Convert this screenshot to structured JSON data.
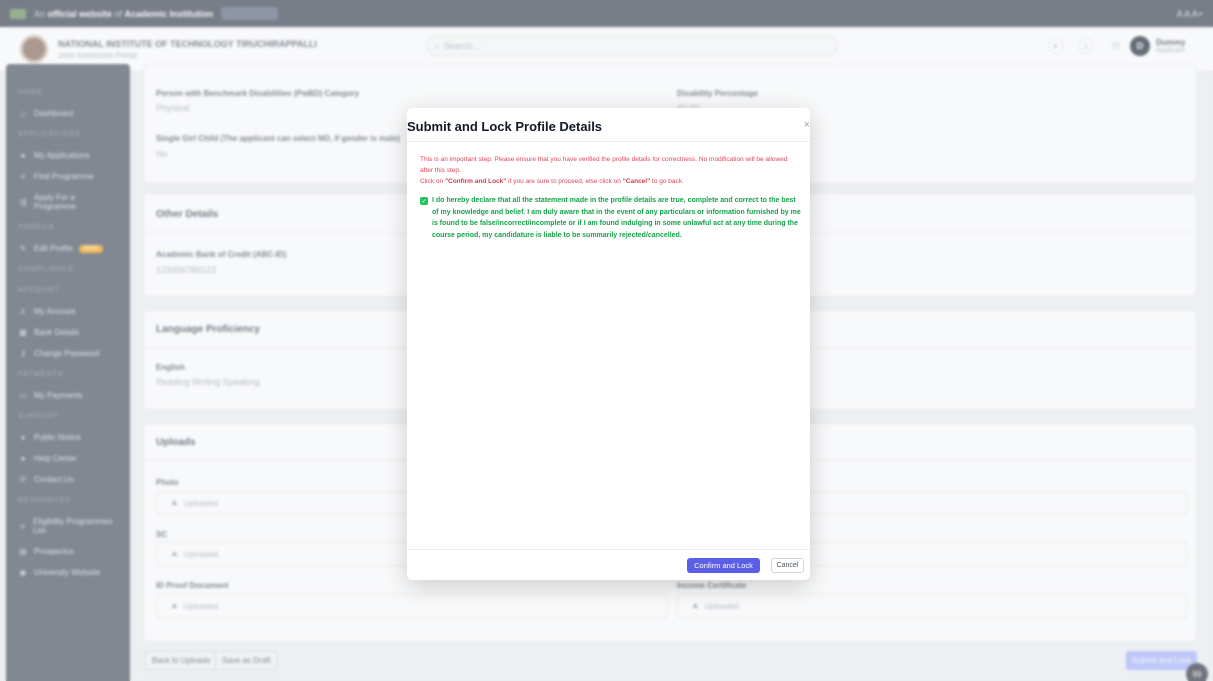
{
  "topbar": {
    "prefix": "An",
    "gov_text": "official website",
    "of_text": "of",
    "ministry": "Academic Institution",
    "helpline": "",
    "right": "A  A  A+"
  },
  "header": {
    "institute_name": "NATIONAL INSTITUTE OF TECHNOLOGY TIRUCHIRAPPALLI",
    "portal_sub": "Joint Admission Portal",
    "search_placeholder": "Search...",
    "avatar_letter": "D",
    "user_name": "Dummy",
    "user_role": "Applicant"
  },
  "sidebar": {
    "sections": [
      {
        "label": "HOME",
        "items": [
          {
            "icon": "home-icon",
            "label": "Dashboard"
          }
        ]
      },
      {
        "label": "APPLICATIONS",
        "items": [
          {
            "icon": "doc-icon",
            "label": "My Applications"
          },
          {
            "icon": "list-icon",
            "label": "Find Programme"
          },
          {
            "icon": "apply-icon",
            "label": "Apply For a Programme"
          }
        ]
      },
      {
        "label": "PROFILE",
        "items": [
          {
            "icon": "edit-icon",
            "label": "Edit Profile",
            "badge": "NEW"
          }
        ]
      },
      {
        "label": "COMPLIANCE",
        "items": []
      },
      {
        "label": "ACCOUNT",
        "items": [
          {
            "icon": "user-icon",
            "label": "My Account"
          },
          {
            "icon": "bank-icon",
            "label": "Bank Details"
          },
          {
            "icon": "key-icon",
            "label": "Change Password"
          }
        ]
      },
      {
        "label": "PAYMENTS",
        "items": [
          {
            "icon": "card-icon",
            "label": "My Payments"
          }
        ]
      },
      {
        "label": "SUPPORT",
        "items": [
          {
            "icon": "notice-icon",
            "label": "Public Notice"
          },
          {
            "icon": "help-icon",
            "label": "Help Center"
          },
          {
            "icon": "phone-icon",
            "label": "Contact Us"
          }
        ]
      },
      {
        "label": "RESOURCES",
        "items": [
          {
            "icon": "list-icon",
            "label": "Eligibility Programmes List"
          },
          {
            "icon": "book-icon",
            "label": "Prospectus"
          },
          {
            "icon": "globe-icon",
            "label": "University Website"
          }
        ]
      }
    ]
  },
  "main": {
    "pwbd_label": "Person with Benchmark Disabilities (PwBD) Category",
    "pwbd_value": "Physical",
    "disability_label": "Disability Percentage",
    "disability_value": "40.00",
    "single_girl_label": "Single Girl Child (The applicant can select NO, if gender is male)",
    "single_girl_value": "No",
    "other_title": "Other Details",
    "abc_label": "Academic Bank of Credit (ABC-ID)",
    "abc_value": "123456789123",
    "language_title": "Language Proficiency",
    "language_label": "English",
    "language_value": "Reading Writing Speaking",
    "uploads_title": "Uploads",
    "photo_label": "Photo",
    "sc_label": "SC",
    "idproof_label": "ID Proof Document",
    "income_label": "Income Certificate",
    "uploaded_text": "Uploaded",
    "back_button": "Back to Uploads",
    "draft_button": "Save as Draft",
    "submit_button": "Submit and Lock",
    "chat_label": "99"
  },
  "modal": {
    "title": "Submit and Lock Profile Details",
    "close": "×",
    "warning_line1": "This is an important step. Please ensure that you have verified the profile details for correctness. No modification will be allowed after this step.",
    "warning_prefix": "Click on ",
    "warning_confirm": "\"Confirm and Lock\"",
    "warning_mid": " if you are sure to proceed, else click on ",
    "warning_cancel": "\"Cancel\"",
    "warning_suffix": " to go back.",
    "declaration": "I do hereby declare that all the statement made in the profile details are true, complete and correct to the best of my knowledge and belief. I am duly aware that in the event of any particulars or information furnished by me is found to be false/incorrect/incomplete or if I am found indulging in some unlawful act at any time during the course period, my candidature is liable to be summarily rejected/cancelled.",
    "confirm_button": "Confirm and Lock",
    "cancel_button": "Cancel"
  },
  "colors": {
    "primary": "#5b5fe6",
    "warning": "#e0455a",
    "success": "#16a34a",
    "sidebar": "#4a5260"
  }
}
